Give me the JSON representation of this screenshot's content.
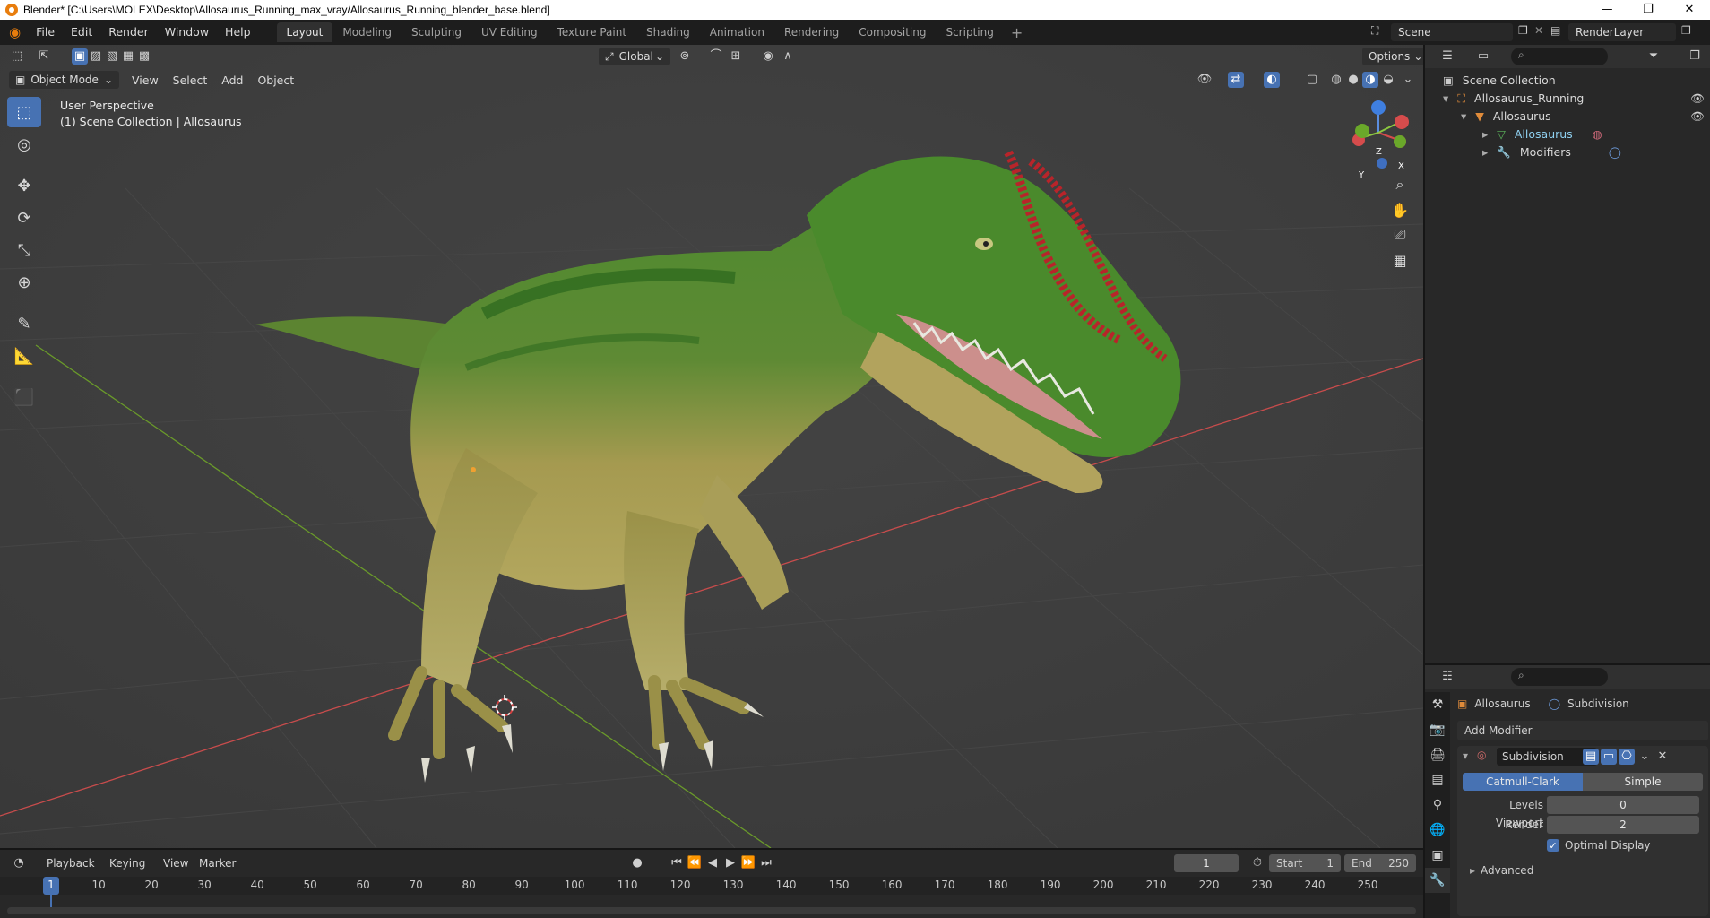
{
  "window": {
    "title": "Blender* [C:\\Users\\MOLEX\\Desktop\\Allosaurus_Running_max_vray/Allosaurus_Running_blender_base.blend]",
    "controls": [
      "—",
      "❐",
      "✕"
    ]
  },
  "menu": {
    "items": [
      "File",
      "Edit",
      "Render",
      "Window",
      "Help"
    ],
    "workspaces": [
      "Layout",
      "Modeling",
      "Sculpting",
      "UV Editing",
      "Texture Paint",
      "Shading",
      "Animation",
      "Rendering",
      "Compositing",
      "Scripting"
    ],
    "active_workspace": "Layout",
    "scene": "Scene",
    "render_layer": "RenderLayer"
  },
  "viewport": {
    "mode": "Object Mode",
    "menus": [
      "View",
      "Select",
      "Add",
      "Object"
    ],
    "transform_orientation": "Global",
    "options_label": "Options",
    "perspective_label": "User Perspective",
    "collection_label": "(1) Scene Collection | Allosaurus",
    "gizmo_axes": {
      "x": "X",
      "y": "Y",
      "z": "Z"
    }
  },
  "toolbar": {
    "tools": [
      "select-box",
      "cursor",
      "move",
      "rotate",
      "scale",
      "transform",
      "annotate",
      "measure",
      "add-cube"
    ]
  },
  "outliner": {
    "root": "Scene Collection",
    "items": [
      {
        "label": "Allosaurus_Running",
        "level": 1
      },
      {
        "label": "Allosaurus",
        "level": 2
      },
      {
        "label": "Allosaurus",
        "level": 3
      },
      {
        "label": "Modifiers",
        "level": 3
      }
    ]
  },
  "properties": {
    "object_name": "Allosaurus",
    "modifier_breadcrumb": "Subdivision",
    "add_modifier_label": "Add Modifier",
    "modifier": {
      "name": "Subdivision",
      "type_options": [
        "Catmull-Clark",
        "Simple"
      ],
      "active_type": "Catmull-Clark",
      "levels_viewport_label": "Levels Viewport",
      "levels_viewport_value": "0",
      "render_label": "Render",
      "render_value": "2",
      "optimal_display_label": "Optimal Display",
      "optimal_display_checked": true,
      "advanced_label": "Advanced"
    }
  },
  "timeline": {
    "menus": [
      "Playback",
      "Keying",
      "View",
      "Marker"
    ],
    "current_frame": "1",
    "start_label": "Start",
    "start_value": "1",
    "end_label": "End",
    "end_value": "250",
    "ticks": [
      "1",
      "10",
      "20",
      "30",
      "40",
      "50",
      "60",
      "70",
      "80",
      "90",
      "100",
      "110",
      "120",
      "130",
      "140",
      "150",
      "160",
      "170",
      "180",
      "190",
      "200",
      "210",
      "220",
      "230",
      "240",
      "250"
    ]
  },
  "colors": {
    "accent": "#4772b3",
    "x_axis": "#c84c4c",
    "y_axis": "#6a9a2a",
    "dino_green": "#3f7a2a",
    "dino_belly": "#a99a4c",
    "crest_red": "#b8242a"
  }
}
